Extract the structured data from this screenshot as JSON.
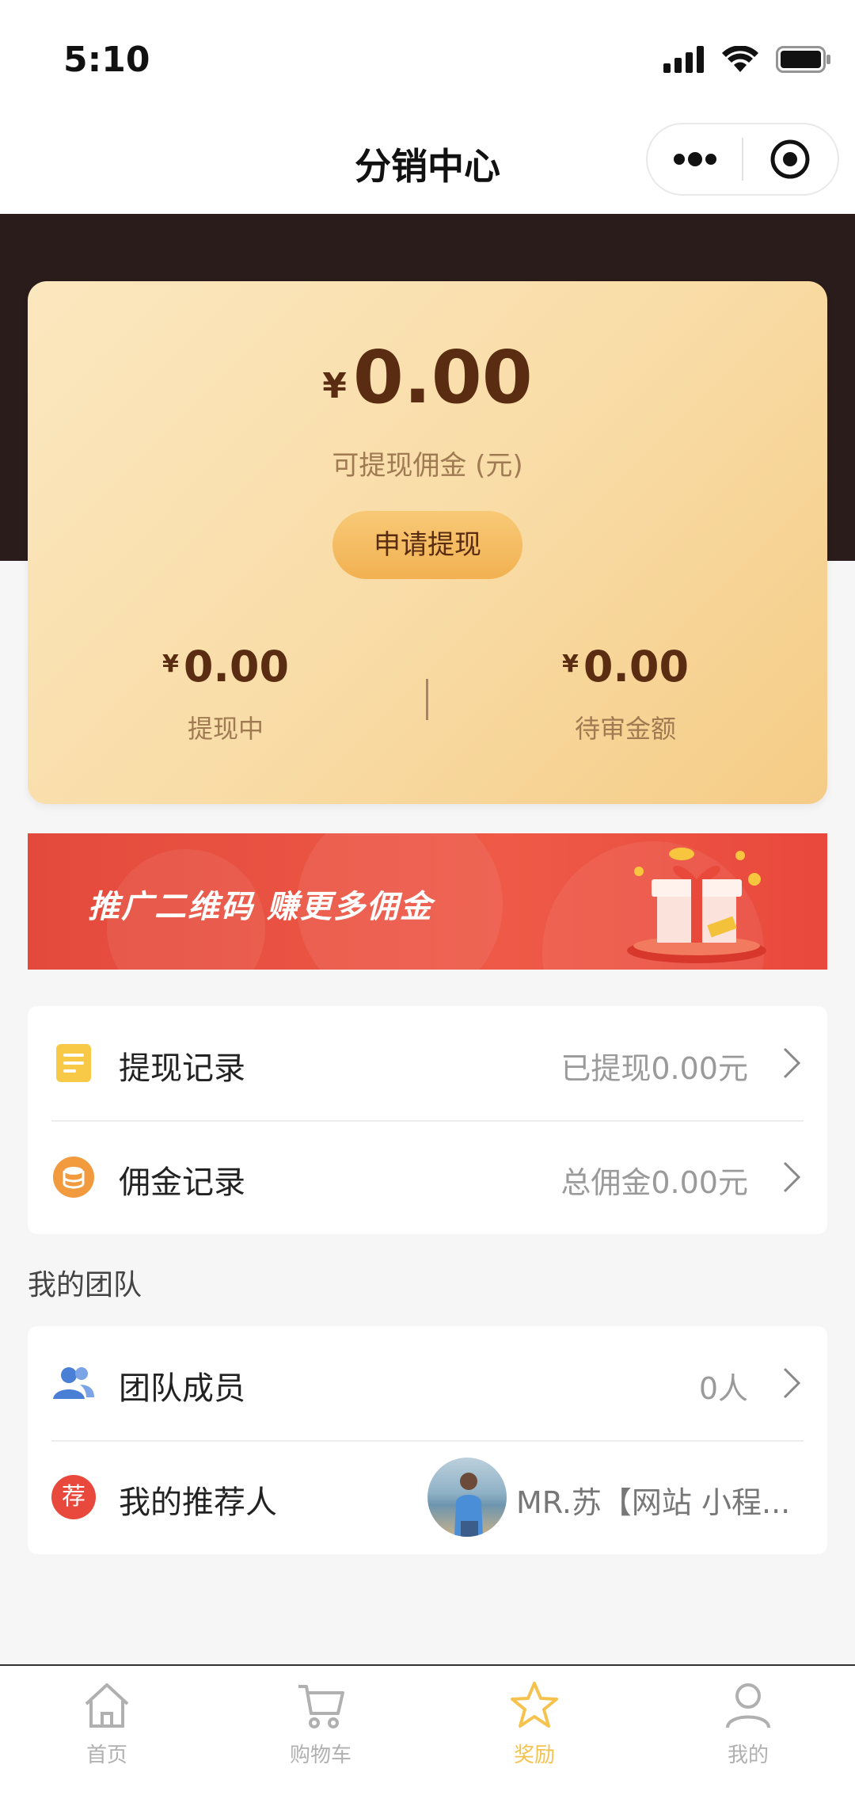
{
  "status_bar": {
    "time": "5:10"
  },
  "nav": {
    "title": "分销中心"
  },
  "card": {
    "currency": "¥",
    "available_amount": "0.00",
    "available_label": "可提现佣金 (元)",
    "withdraw_button": "申请提现",
    "stats": [
      {
        "amount": "0.00",
        "label": "提现中"
      },
      {
        "amount": "0.00",
        "label": "待审金额"
      }
    ]
  },
  "banner": {
    "text": "推广二维码  赚更多佣金"
  },
  "records": [
    {
      "icon": "document-icon",
      "title": "提现记录",
      "value": "已提现0.00元"
    },
    {
      "icon": "coins-icon",
      "title": "佣金记录",
      "value": "总佣金0.00元"
    }
  ],
  "team": {
    "section_title": "我的团队",
    "members": {
      "icon": "users-icon",
      "title": "团队成员",
      "value": "0人"
    },
    "referrer": {
      "icon_text": "荐",
      "title": "我的推荐人",
      "name": "MR.苏【网站 小程..."
    }
  },
  "tabbar": {
    "items": [
      {
        "label": "首页",
        "icon": "home-icon"
      },
      {
        "label": "购物车",
        "icon": "cart-icon"
      },
      {
        "label": "奖励",
        "icon": "star-icon",
        "active": true
      },
      {
        "label": "我的",
        "icon": "user-icon"
      }
    ]
  },
  "colors": {
    "dark_band": "#2a1c1b",
    "gold_card": "#f9dda8",
    "amount_text": "#5a2c12",
    "banner_red": "#e9483c",
    "active_tab": "#f5c24d"
  }
}
